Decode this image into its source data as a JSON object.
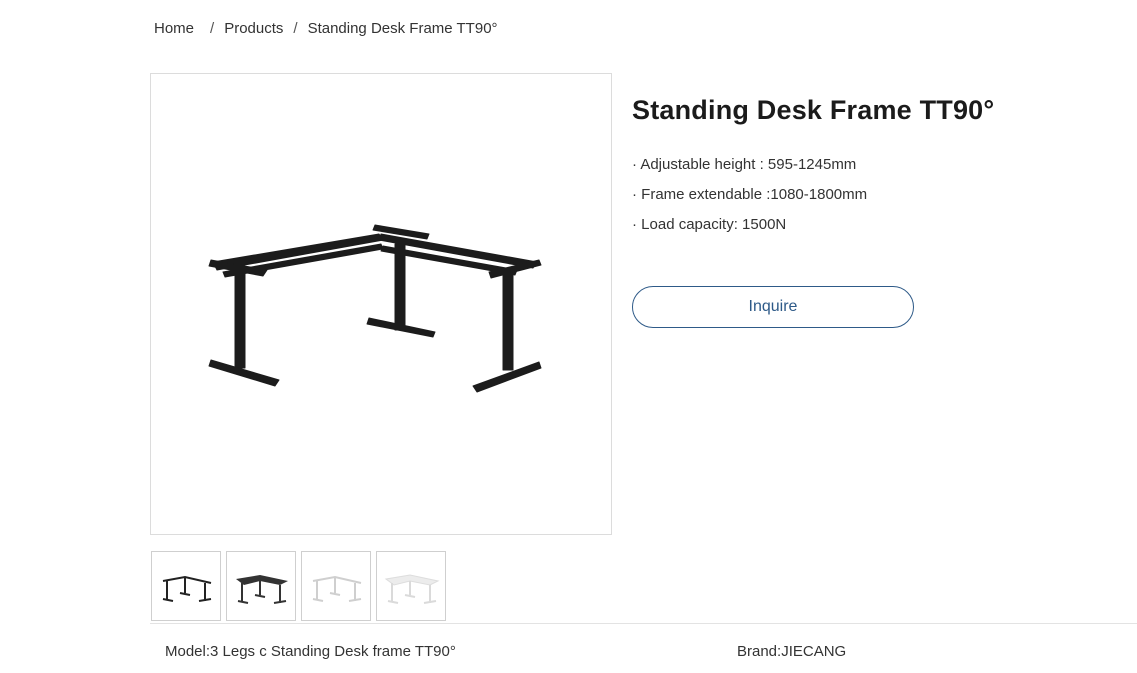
{
  "breadcrumb": {
    "home": "Home",
    "sep1": "/",
    "products": "Products",
    "sep2": "/",
    "current": "Standing Desk Frame TT90°"
  },
  "product": {
    "title": "Standing Desk Frame TT90°",
    "specs": [
      "· Adjustable height : 595-1245mm",
      "· Frame extendable :1080-1800mm",
      "· Load capacity: 1500N"
    ],
    "inquire_label": "Inquire"
  },
  "gallery": {
    "thumbnails": [
      {
        "icon": "black-frame-icon",
        "color": "#222222"
      },
      {
        "icon": "black-frame-with-top-icon",
        "color": "#333333"
      },
      {
        "icon": "white-frame-icon",
        "color": "#d8d8d8"
      },
      {
        "icon": "white-frame-with-top-icon",
        "color": "#e2e2e2"
      }
    ]
  },
  "meta": {
    "model": "Model:3 Legs c Standing Desk frame TT90°",
    "brand": "Brand:JIECANG"
  },
  "colors": {
    "accent": "#2e5a88",
    "frame": "#1c1c1c"
  }
}
